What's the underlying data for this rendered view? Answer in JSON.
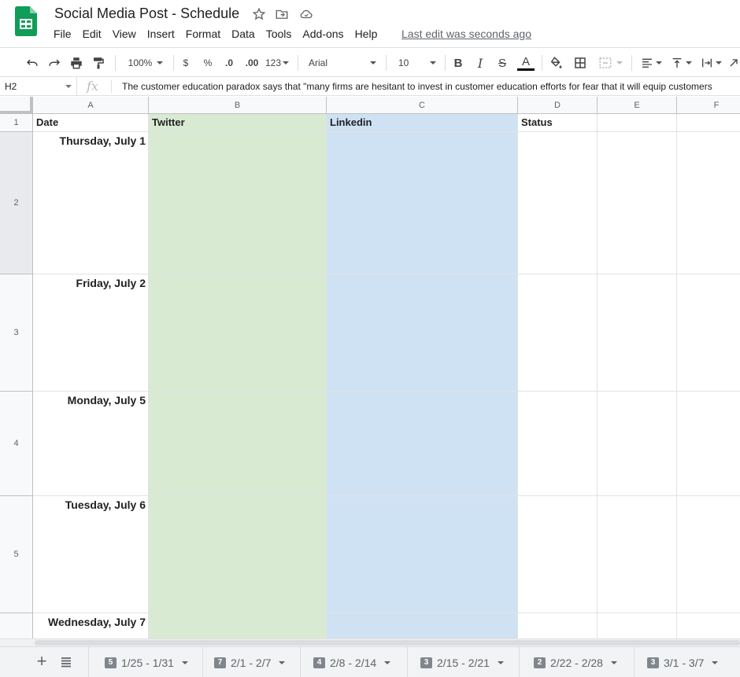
{
  "app": {
    "title": "Social Media Post - Schedule",
    "last_edit": "Last edit was seconds ago"
  },
  "menu": [
    "File",
    "Edit",
    "View",
    "Insert",
    "Format",
    "Data",
    "Tools",
    "Add-ons",
    "Help"
  ],
  "toolbar": {
    "zoom": "100%",
    "currency": "$",
    "percent": "%",
    "decrease_decimal": ".0",
    "increase_decimal": ".00",
    "more_formats": "123",
    "font": "Arial",
    "font_size": "10",
    "bold": "B",
    "italic": "I",
    "strike": "S",
    "text_color_letter": "A",
    "text_color": "#000000"
  },
  "formula_bar": {
    "cell_ref": "H2",
    "fx": "fx",
    "content": "The customer education paradox says that \"many firms are hesitant to invest in customer education efforts for fear that it will equip customers"
  },
  "columns": [
    "A",
    "B",
    "C",
    "D",
    "E",
    "F"
  ],
  "rows": [
    "1",
    "2",
    "3",
    "4",
    "5"
  ],
  "headers": {
    "date": "Date",
    "twitter": "Twitter",
    "linkedin": "Linkedin",
    "status": "Status"
  },
  "dates": [
    "Thursday, July 1",
    "Friday, July 2",
    "Monday, July 5",
    "Tuesday, July 6",
    "Wednesday, July 7"
  ],
  "colors": {
    "twitter_fill": "#d9ead3",
    "linkedin_fill": "#cfe2f3",
    "sheets_green": "#0f9d58"
  },
  "sheet_tabs": [
    {
      "badge": "5",
      "label": "1/25 - 1/31"
    },
    {
      "badge": "7",
      "label": "2/1 - 2/7"
    },
    {
      "badge": "4",
      "label": "2/8 - 2/14"
    },
    {
      "badge": "3",
      "label": "2/15 - 2/21"
    },
    {
      "badge": "2",
      "label": "2/22 - 2/28"
    },
    {
      "badge": "3",
      "label": "3/1 - 3/7"
    }
  ]
}
